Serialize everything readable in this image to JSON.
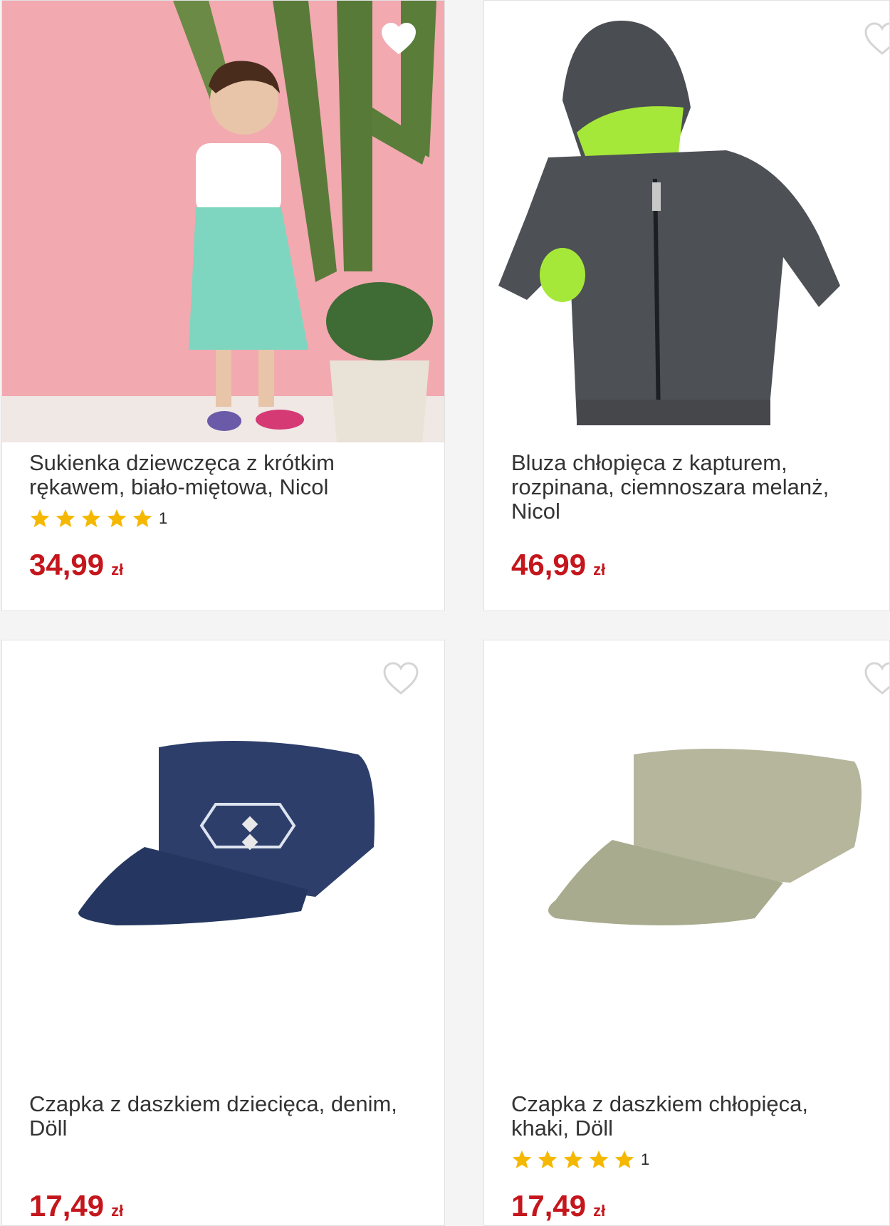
{
  "products": [
    {
      "title": "Sukienka dziewczęca z krótkim rękawem, biało-miętowa, Nicol",
      "rating_count": "1",
      "price": "34,99",
      "currency": "zł",
      "rating_stars": 5,
      "favorited_style": "white-filled"
    },
    {
      "title": "Bluza chłopięca z kapturem, rozpinana, ciemnoszara melanż, Nicol",
      "price": "46,99",
      "currency": "zł"
    },
    {
      "title": "Czapka z daszkiem dziecięca, denim, Döll",
      "price": "17,49",
      "currency": "zł"
    },
    {
      "title": "Czapka z daszkiem chłopięca, khaki, Döll",
      "rating_count": "1",
      "price": "17,49",
      "currency": "zł",
      "rating_stars": 5
    }
  ],
  "colors": {
    "price": "#c4161c",
    "star": "#f5b800",
    "title": "#333333"
  },
  "icons": {
    "favorite": "heart-outline-icon",
    "rating": "star-icon"
  }
}
